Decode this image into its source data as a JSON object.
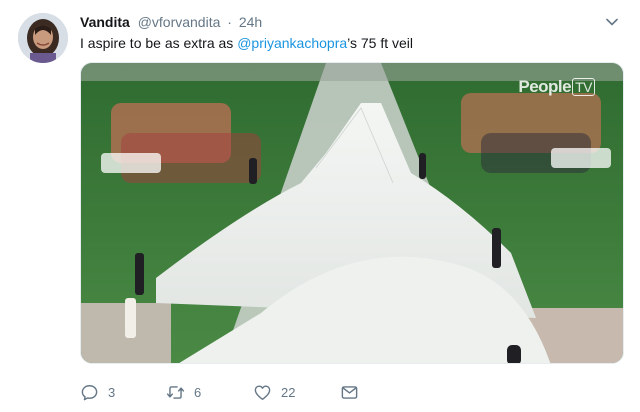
{
  "tweet": {
    "author_name": "Vandita",
    "handle": "@vforvandita",
    "separator": "·",
    "time": "24h",
    "text_before": "I aspire to be as extra as ",
    "mention": "@priyankachopra",
    "text_after": "’s 75 ft veil"
  },
  "media": {
    "watermark_brand": "People",
    "watermark_tv": "TV"
  },
  "actions": {
    "reply_count": "3",
    "retweet_count": "6",
    "like_count": "22"
  },
  "colors": {
    "link": "#1b95e0",
    "meta_gray": "#657786",
    "lawn_green": "#3f7a3c"
  }
}
